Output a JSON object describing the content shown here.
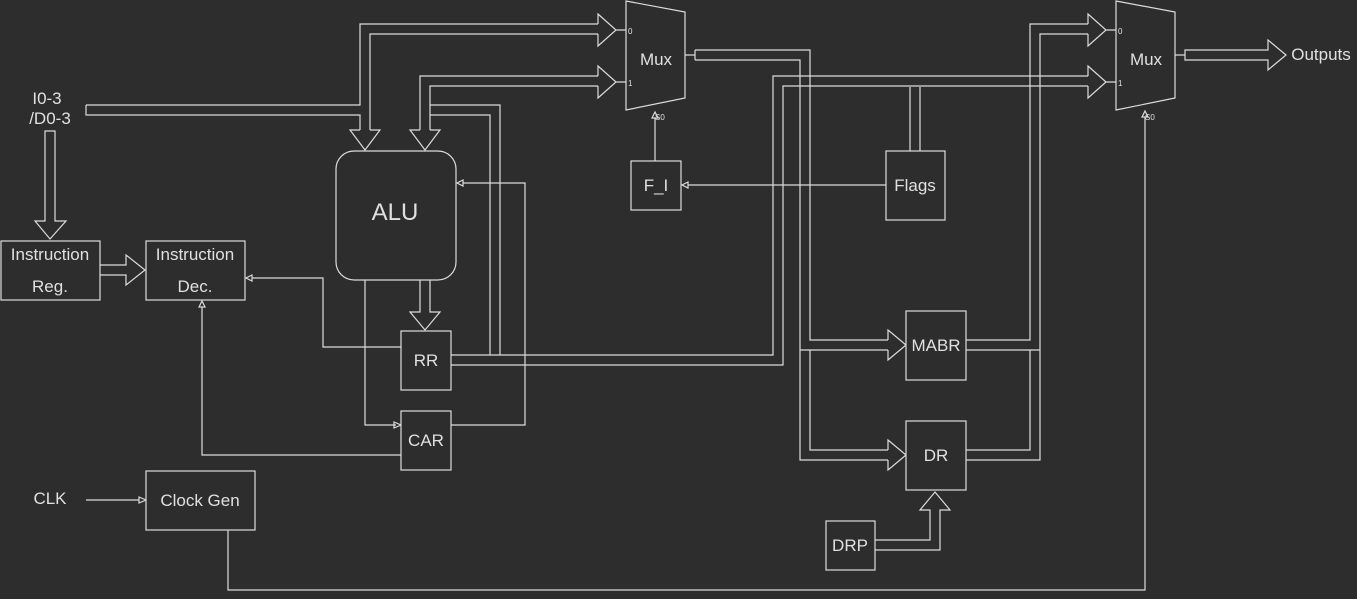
{
  "diagram": {
    "background": "#2d2d2d",
    "stroke_color": "#dcdcdc",
    "inputs": {
      "io_line1": "I0-3",
      "io_line2": "/D0-3",
      "clk": "CLK"
    },
    "blocks": {
      "instruction_reg": {
        "line1": "Instruction",
        "line2": "Reg."
      },
      "instruction_dec": {
        "line1": "Instruction",
        "line2": "Dec."
      },
      "alu": "ALU",
      "rr": "RR",
      "car": "CAR",
      "clock_gen": "Clock Gen",
      "f_i": "F_I",
      "flags": "Flags",
      "mabr": "MABR",
      "dr": "DR",
      "drp": "DRP"
    },
    "mux1": {
      "label": "Mux",
      "in0": "0",
      "in1": "1",
      "sel": "S0"
    },
    "mux2": {
      "label": "Mux",
      "in0": "0",
      "in1": "1",
      "sel": "S0"
    },
    "outputs": "Outputs"
  }
}
